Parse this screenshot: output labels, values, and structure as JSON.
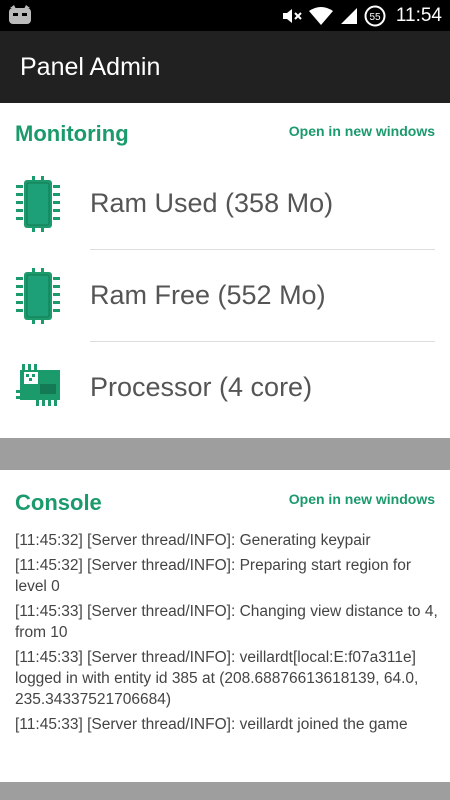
{
  "status_bar": {
    "time": "11:54",
    "battery_level": "55",
    "icons": [
      "android-app-icon",
      "mute-icon",
      "wifi-icon",
      "signal-icon",
      "battery-icon"
    ]
  },
  "app_bar": {
    "title": "Panel Admin"
  },
  "monitoring": {
    "title": "Monitoring",
    "open_link": "Open in new windows",
    "items": [
      {
        "label": "Ram Used (358 Mo)",
        "icon": "memory-chip-icon"
      },
      {
        "label": "Ram Free (552 Mo)",
        "icon": "memory-chip-icon"
      },
      {
        "label": "Processor (4 core)",
        "icon": "processor-icon"
      }
    ]
  },
  "console": {
    "title": "Console",
    "open_link": "Open in new windows",
    "lines": [
      "[11:45:32] [Server thread/INFO]: Generating keypair",
      "[11:45:32] [Server thread/INFO]: Preparing start region for level 0",
      "[11:45:33] [Server thread/INFO]: Changing view distance to 4, from 10",
      "[11:45:33] [Server thread/INFO]: veillardt[local:E:f07a311e] logged in with entity id 385 at (208.68876613618139, 64.0, 235.34337521706684)",
      "[11:45:33] [Server thread/INFO]: veillardt joined the game"
    ]
  },
  "colors": {
    "accent": "#1b9a6c",
    "appbar": "#212121",
    "status": "#000000",
    "band": "#9e9e9e"
  }
}
